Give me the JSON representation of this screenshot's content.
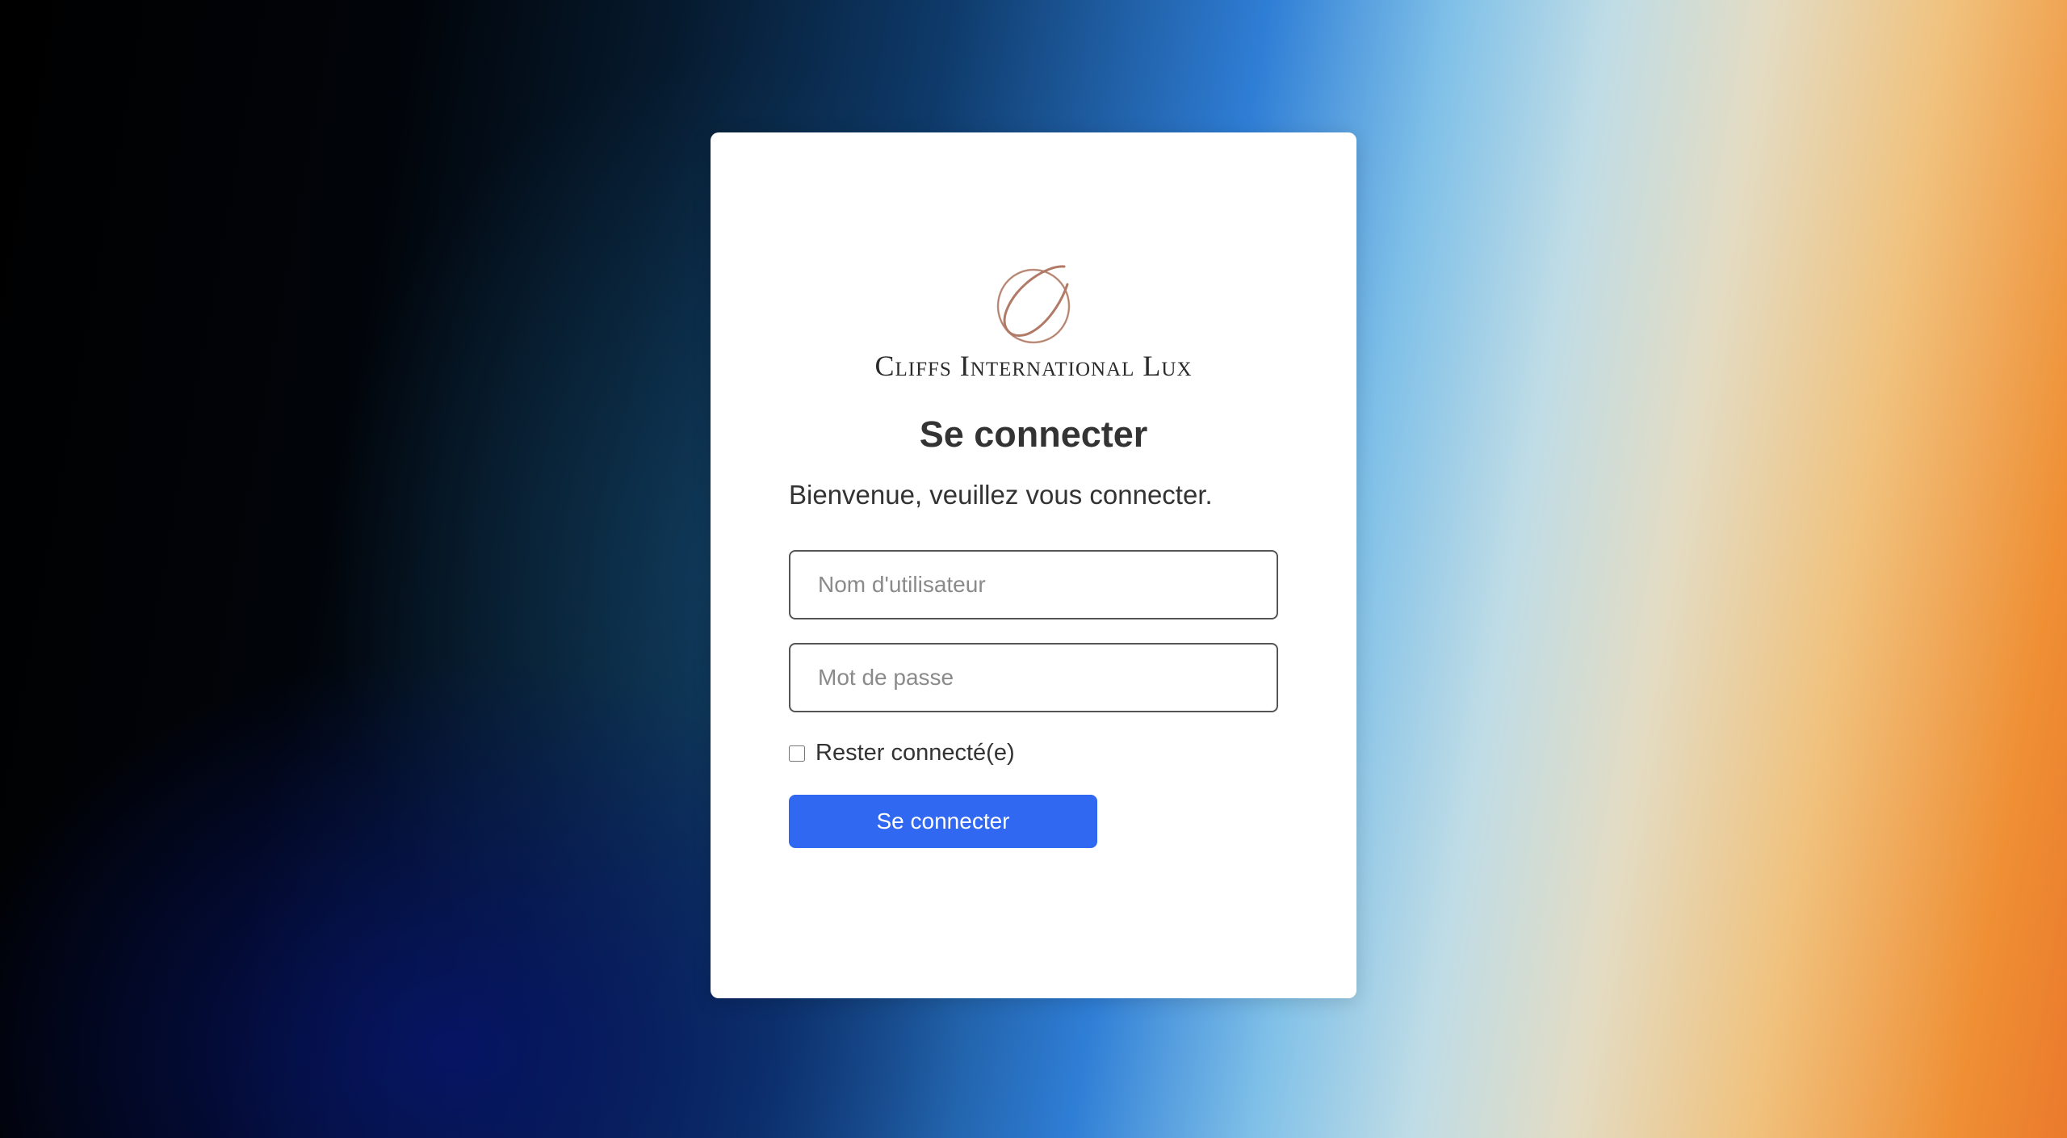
{
  "brand": {
    "name": "Cliffs International Lux",
    "logo_icon": "globe-ring-logo-icon",
    "logo_color": "#b88674"
  },
  "login": {
    "title": "Se connecter",
    "welcome": "Bienvenue, veuillez vous connecter.",
    "username": {
      "placeholder": "Nom d'utilisateur",
      "value": ""
    },
    "password": {
      "placeholder": "Mot de passe",
      "value": ""
    },
    "remember_label": "Rester connecté(e)",
    "remember_checked": false,
    "submit_label": "Se connecter"
  },
  "colors": {
    "primary": "#3168f2",
    "card_background": "#ffffff",
    "text": "#333333"
  }
}
